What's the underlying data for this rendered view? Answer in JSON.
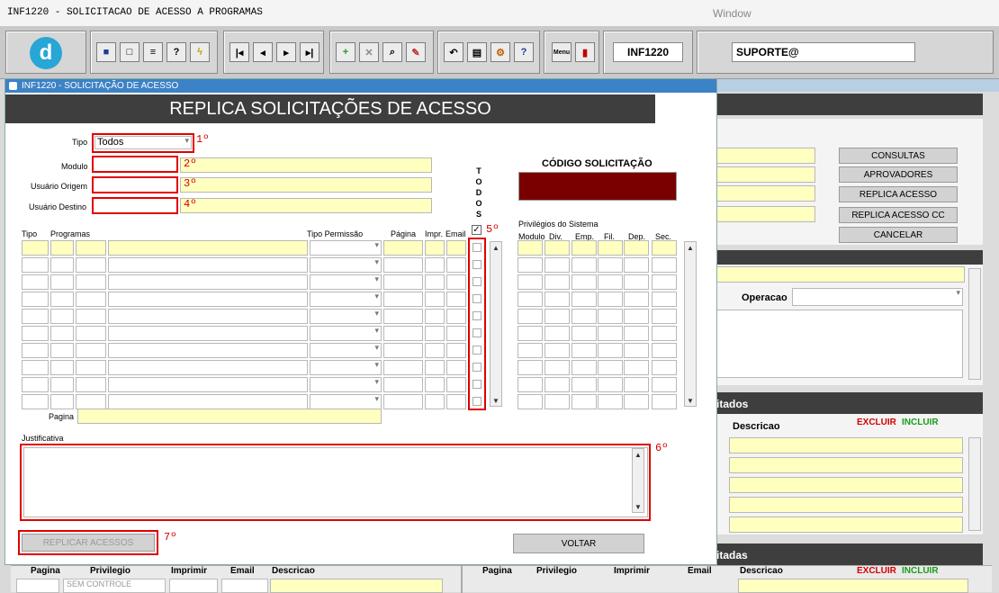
{
  "window": {
    "title": "INF1220 - SOLICITACAO DE ACESSO A PROGRAMAS",
    "menu": "Window"
  },
  "toolbar": {
    "form_code": "INF1220",
    "user": "SUPORTE@",
    "logo": "d"
  },
  "bg": {
    "buttons": [
      "CONSULTAS",
      "APROVADORES",
      "REPLICA ACESSO",
      "REPLICA ACESSO CC",
      "CANCELAR"
    ],
    "operacao_label": "Operacao",
    "section1": "itados",
    "section2": "itadas",
    "descricao": "Descricao",
    "excluir": "EXCLUIR",
    "incluir": "INCLUIR",
    "bottom_headers": [
      "Pagina",
      "Privilegio",
      "Imprimir",
      "Email",
      "Descricao"
    ],
    "bottom_headers_right": [
      "Pagina",
      "Privilegio",
      "Imprimir",
      "Email",
      "Descricao"
    ],
    "sem_controle": "SEM CONTROLE"
  },
  "dialog": {
    "title": "INF1220 - SOLICITAÇÃO DE ACESSO",
    "heading": "REPLICA SOLICITAÇÕES DE ACESSO",
    "tipo_label": "Tipo",
    "tipo_value": "Todos",
    "modulo_label": "Modulo",
    "usuario_origem_label": "Usuário Origem",
    "usuario_destino_label": "Usuário Destino",
    "todos_label": "TODOS",
    "codigo_label": "CÓDIGO SOLICITAÇÃO",
    "grid_headers": {
      "tipo": "Tipo",
      "programas": "Programas",
      "tipo_permissao": "Tipo Permissão",
      "pagina": "Página",
      "impr": "Impr.",
      "email": "Email"
    },
    "privilegios_label": "Privilégios do Sistema",
    "priv_headers": [
      "Modulo",
      "Div.",
      "Emp.",
      "Fil.",
      "Dep.",
      "Sec."
    ],
    "pagina_label": "Pagina",
    "justificativa_label": "Justificativa",
    "replicar_button": "REPLICAR ACESSOS",
    "voltar_button": "VOLTAR"
  },
  "annotations": [
    "1º",
    "2º",
    "3º",
    "4º",
    "5º",
    "6º",
    "7º"
  ],
  "colors": {
    "codigo_fill": "#7a0000",
    "dialog_title": "#3c82c6",
    "annotation": "#e10000",
    "yellow_field": "#ffffc0"
  }
}
